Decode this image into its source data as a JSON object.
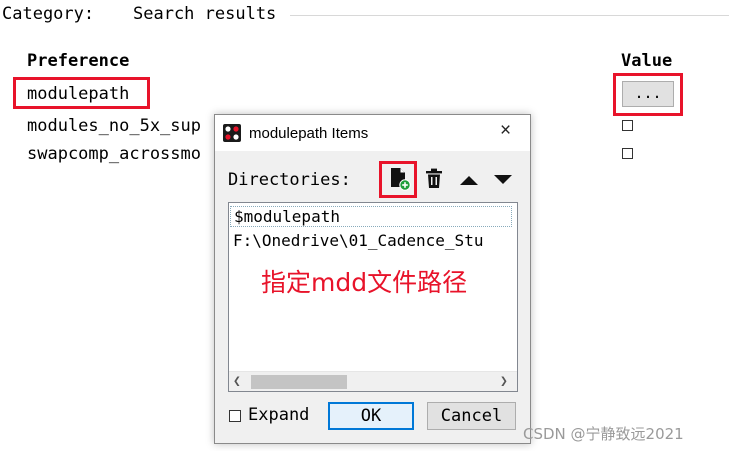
{
  "category": {
    "label": "Category:",
    "value": "Search results"
  },
  "headers": {
    "preference": "Preference",
    "value": "Value"
  },
  "preferences": [
    {
      "name": "modulepath",
      "value_button": "..."
    },
    {
      "name": "modules_no_5x_sup",
      "checked": false
    },
    {
      "name": "swapcomp_acrossmo",
      "checked": false
    }
  ],
  "dialog": {
    "title": "modulepath Items",
    "close_icon": "×",
    "directories_label": "Directories:",
    "toolbar_icons": [
      "add-directory-icon",
      "delete-icon",
      "move-up-icon",
      "move-down-icon"
    ],
    "list_items": [
      "$modulepath",
      "F:\\Onedrive\\01_Cadence_Stu"
    ],
    "expand_label": "Expand",
    "expand_checked": false,
    "ok_label": "OK",
    "cancel_label": "Cancel"
  },
  "annotation": "指定mdd文件路径",
  "watermark": "CSDN @宁静致远2021",
  "colors": {
    "highlight": "#e8132a",
    "accent": "#0078d7"
  }
}
